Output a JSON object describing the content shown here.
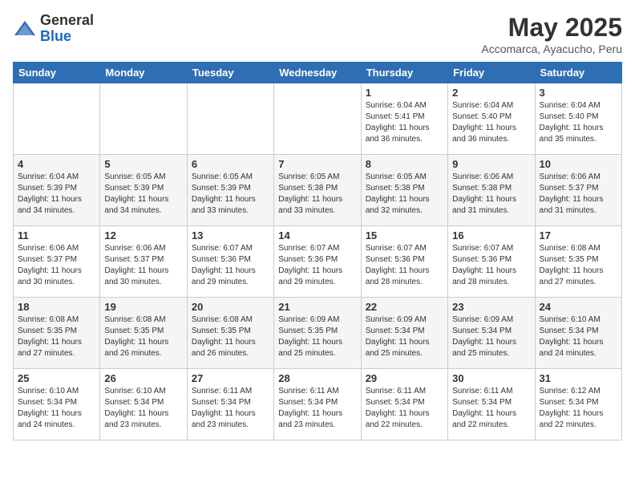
{
  "header": {
    "logo_general": "General",
    "logo_blue": "Blue",
    "month_title": "May 2025",
    "location": "Accomarca, Ayacucho, Peru"
  },
  "days_of_week": [
    "Sunday",
    "Monday",
    "Tuesday",
    "Wednesday",
    "Thursday",
    "Friday",
    "Saturday"
  ],
  "weeks": [
    [
      {
        "day": "",
        "info": ""
      },
      {
        "day": "",
        "info": ""
      },
      {
        "day": "",
        "info": ""
      },
      {
        "day": "",
        "info": ""
      },
      {
        "day": "1",
        "info": "Sunrise: 6:04 AM\nSunset: 5:41 PM\nDaylight: 11 hours\nand 36 minutes."
      },
      {
        "day": "2",
        "info": "Sunrise: 6:04 AM\nSunset: 5:40 PM\nDaylight: 11 hours\nand 36 minutes."
      },
      {
        "day": "3",
        "info": "Sunrise: 6:04 AM\nSunset: 5:40 PM\nDaylight: 11 hours\nand 35 minutes."
      }
    ],
    [
      {
        "day": "4",
        "info": "Sunrise: 6:04 AM\nSunset: 5:39 PM\nDaylight: 11 hours\nand 34 minutes."
      },
      {
        "day": "5",
        "info": "Sunrise: 6:05 AM\nSunset: 5:39 PM\nDaylight: 11 hours\nand 34 minutes."
      },
      {
        "day": "6",
        "info": "Sunrise: 6:05 AM\nSunset: 5:39 PM\nDaylight: 11 hours\nand 33 minutes."
      },
      {
        "day": "7",
        "info": "Sunrise: 6:05 AM\nSunset: 5:38 PM\nDaylight: 11 hours\nand 33 minutes."
      },
      {
        "day": "8",
        "info": "Sunrise: 6:05 AM\nSunset: 5:38 PM\nDaylight: 11 hours\nand 32 minutes."
      },
      {
        "day": "9",
        "info": "Sunrise: 6:06 AM\nSunset: 5:38 PM\nDaylight: 11 hours\nand 31 minutes."
      },
      {
        "day": "10",
        "info": "Sunrise: 6:06 AM\nSunset: 5:37 PM\nDaylight: 11 hours\nand 31 minutes."
      }
    ],
    [
      {
        "day": "11",
        "info": "Sunrise: 6:06 AM\nSunset: 5:37 PM\nDaylight: 11 hours\nand 30 minutes."
      },
      {
        "day": "12",
        "info": "Sunrise: 6:06 AM\nSunset: 5:37 PM\nDaylight: 11 hours\nand 30 minutes."
      },
      {
        "day": "13",
        "info": "Sunrise: 6:07 AM\nSunset: 5:36 PM\nDaylight: 11 hours\nand 29 minutes."
      },
      {
        "day": "14",
        "info": "Sunrise: 6:07 AM\nSunset: 5:36 PM\nDaylight: 11 hours\nand 29 minutes."
      },
      {
        "day": "15",
        "info": "Sunrise: 6:07 AM\nSunset: 5:36 PM\nDaylight: 11 hours\nand 28 minutes."
      },
      {
        "day": "16",
        "info": "Sunrise: 6:07 AM\nSunset: 5:36 PM\nDaylight: 11 hours\nand 28 minutes."
      },
      {
        "day": "17",
        "info": "Sunrise: 6:08 AM\nSunset: 5:35 PM\nDaylight: 11 hours\nand 27 minutes."
      }
    ],
    [
      {
        "day": "18",
        "info": "Sunrise: 6:08 AM\nSunset: 5:35 PM\nDaylight: 11 hours\nand 27 minutes."
      },
      {
        "day": "19",
        "info": "Sunrise: 6:08 AM\nSunset: 5:35 PM\nDaylight: 11 hours\nand 26 minutes."
      },
      {
        "day": "20",
        "info": "Sunrise: 6:08 AM\nSunset: 5:35 PM\nDaylight: 11 hours\nand 26 minutes."
      },
      {
        "day": "21",
        "info": "Sunrise: 6:09 AM\nSunset: 5:35 PM\nDaylight: 11 hours\nand 25 minutes."
      },
      {
        "day": "22",
        "info": "Sunrise: 6:09 AM\nSunset: 5:34 PM\nDaylight: 11 hours\nand 25 minutes."
      },
      {
        "day": "23",
        "info": "Sunrise: 6:09 AM\nSunset: 5:34 PM\nDaylight: 11 hours\nand 25 minutes."
      },
      {
        "day": "24",
        "info": "Sunrise: 6:10 AM\nSunset: 5:34 PM\nDaylight: 11 hours\nand 24 minutes."
      }
    ],
    [
      {
        "day": "25",
        "info": "Sunrise: 6:10 AM\nSunset: 5:34 PM\nDaylight: 11 hours\nand 24 minutes."
      },
      {
        "day": "26",
        "info": "Sunrise: 6:10 AM\nSunset: 5:34 PM\nDaylight: 11 hours\nand 23 minutes."
      },
      {
        "day": "27",
        "info": "Sunrise: 6:11 AM\nSunset: 5:34 PM\nDaylight: 11 hours\nand 23 minutes."
      },
      {
        "day": "28",
        "info": "Sunrise: 6:11 AM\nSunset: 5:34 PM\nDaylight: 11 hours\nand 23 minutes."
      },
      {
        "day": "29",
        "info": "Sunrise: 6:11 AM\nSunset: 5:34 PM\nDaylight: 11 hours\nand 22 minutes."
      },
      {
        "day": "30",
        "info": "Sunrise: 6:11 AM\nSunset: 5:34 PM\nDaylight: 11 hours\nand 22 minutes."
      },
      {
        "day": "31",
        "info": "Sunrise: 6:12 AM\nSunset: 5:34 PM\nDaylight: 11 hours\nand 22 minutes."
      }
    ]
  ]
}
